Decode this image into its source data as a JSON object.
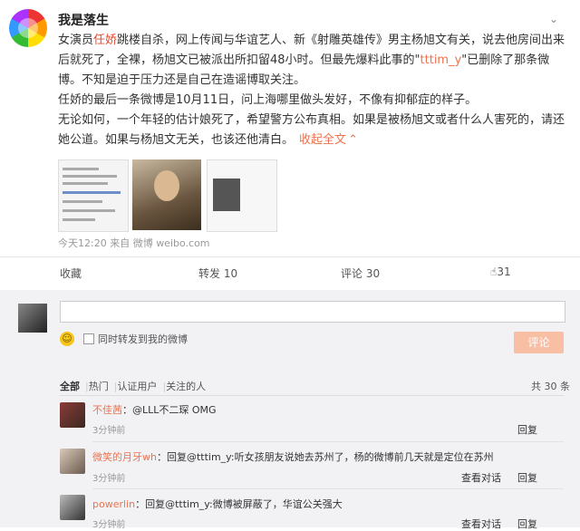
{
  "post": {
    "username": "我是落生",
    "p1_a": "女演员",
    "p1_hl": "任娇",
    "p1_b": "跳楼自杀，网上传闻与华谊艺人、新《射雕英雄传》男主杨旭文有关，说去他房间出来后就死了，全裸，杨旭文已被派出所扣留48小时。但最先爆料此事的\"",
    "p1_link": "tttim_y",
    "p1_c": "\"已删除了那条微博。不知是迫于压力还是自己在造谣博取关注。",
    "p2": "任娇的最后一条微博是10月11日，问上海哪里做头发好，不像有抑郁症的样子。",
    "p3": "无论如何，一个年轻的估计娘死了，希望警方公布真相。如果是被杨旭文或者什么人害死的，请还她公道。如果与杨旭文无关，也该还他清白。",
    "collapse": "收起全文",
    "meta": "今天12:20 来自 微博 weibo.com"
  },
  "actions": {
    "favorite": "收藏",
    "repost": "转发 10",
    "comment": "评论 30",
    "like": "31"
  },
  "compose": {
    "repost_label": "同时转发到我的微博",
    "submit": "评论"
  },
  "filters": {
    "all": "全部",
    "hot": "热门",
    "verified": "认证用户",
    "following": "关注的人",
    "total": "共 30 条"
  },
  "comments": [
    {
      "name": "不佳茜",
      "text": "：@LLL不二琛 OMG",
      "time": "3分钟前",
      "actions": [
        "回复"
      ]
    },
    {
      "name": "微笑的月牙wh",
      "text": "：回复@tttim_y:听女孩朋友说她去苏州了，杨的微博前几天就是定位在苏州",
      "time": "3分钟前",
      "actions": [
        "查看对话",
        "回复"
      ]
    },
    {
      "name": "powerlin",
      "text": "：回复@tttim_y:微博被屏蔽了，华谊公关强大",
      "time": "3分钟前",
      "actions": [
        "查看对话",
        "回复"
      ]
    }
  ],
  "icons": [
    "chevron-down-icon",
    "emoji-icon",
    "checkbox-icon",
    "thumbs-up-icon"
  ],
  "colors": {
    "accent": "#eb7350",
    "button_disabled": "#f9bfa5",
    "panel_bg": "#f2f2f5"
  }
}
